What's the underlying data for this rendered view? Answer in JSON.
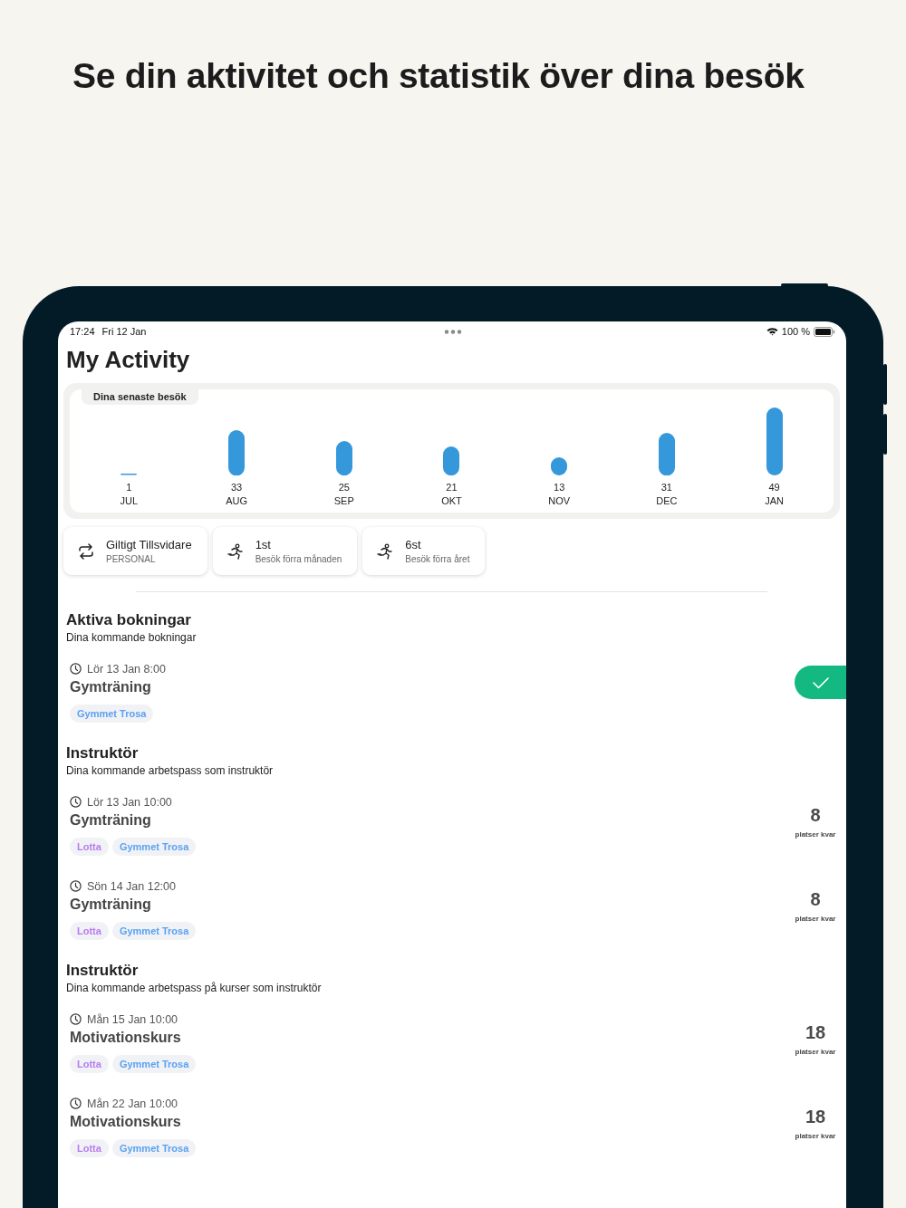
{
  "headline": "Se din aktivitet och statistik över dina besök",
  "status_bar": {
    "time": "17:24",
    "date": "Fri 12 Jan",
    "battery": "100 %"
  },
  "title": "My Activity",
  "visits_chart": {
    "label": "Dina senaste besök",
    "chart_data": {
      "type": "bar",
      "categories": [
        "JUL",
        "AUG",
        "SEP",
        "OKT",
        "NOV",
        "DEC",
        "JAN"
      ],
      "values": [
        1,
        33,
        25,
        21,
        13,
        31,
        49
      ],
      "data_labels": true
    }
  },
  "stats": [
    {
      "kind": "repeat",
      "value": "Giltigt Tillsvidare",
      "label": "PERSONAL"
    },
    {
      "kind": "run",
      "value": "1st",
      "label": "Besök förra månaden"
    },
    {
      "kind": "run",
      "value": "6st",
      "label": "Besök förra året"
    }
  ],
  "sections": [
    {
      "title": "Aktiva bokningar",
      "subtitle": "Dina kommande bokningar",
      "items": [
        {
          "kind": "booking",
          "time": "Lör 13 Jan 8:00",
          "name": "Gymträning",
          "tags": [
            {
              "text": "Gymmet Trosa",
              "color": "#5aa2f2"
            }
          ]
        }
      ]
    },
    {
      "title": "Instruktör",
      "subtitle": "Dina kommande arbetspass som instruktör",
      "items": [
        {
          "kind": "session",
          "time": "Lör 13 Jan 10:00",
          "name": "Gymträning",
          "tags": [
            {
              "text": "Lotta",
              "color": "#b77cf0"
            },
            {
              "text": "Gymmet Trosa",
              "color": "#5aa2f2"
            }
          ],
          "spots": "8",
          "spots_label": "platser kvar"
        },
        {
          "kind": "session",
          "time": "Sön 14 Jan 12:00",
          "name": "Gymträning",
          "tags": [
            {
              "text": "Lotta",
              "color": "#b77cf0"
            },
            {
              "text": "Gymmet Trosa",
              "color": "#5aa2f2"
            }
          ],
          "spots": "8",
          "spots_label": "platser kvar"
        }
      ]
    },
    {
      "title": "Instruktör",
      "subtitle": "Dina kommande arbetspass på kurser som instruktör",
      "items": [
        {
          "kind": "session",
          "time": "Mån 15 Jan 10:00",
          "name": "Motivationskurs",
          "tags": [
            {
              "text": "Lotta",
              "color": "#b77cf0"
            },
            {
              "text": "Gymmet Trosa",
              "color": "#5aa2f2"
            }
          ],
          "spots": "18",
          "spots_label": "platser kvar"
        },
        {
          "kind": "session",
          "time": "Mån 22 Jan 10:00",
          "name": "Motivationskurs",
          "tags": [
            {
              "text": "Lotta",
              "color": "#b77cf0"
            },
            {
              "text": "Gymmet Trosa",
              "color": "#5aa2f2"
            }
          ],
          "spots": "18",
          "spots_label": "platser kvar"
        }
      ]
    }
  ]
}
